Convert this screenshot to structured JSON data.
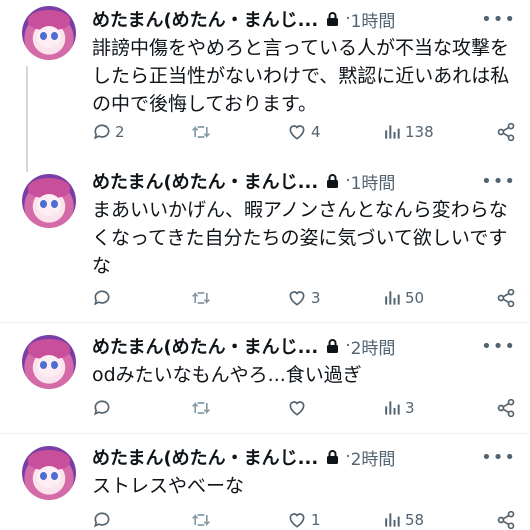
{
  "tweets": [
    {
      "name": "めたまん(めたん・まんじ...",
      "time": "1時間",
      "text": "誹謗中傷をやめろと言っている人が不当な攻撃をしたら正当性がないわけで、黙認に近いあれは私の中で後悔しております。",
      "replies": "2",
      "retweets": "",
      "likes": "4",
      "views": "138"
    },
    {
      "name": "めたまん(めたん・まんじ...",
      "time": "1時間",
      "text": "まあいいかげん、暇アノンさんとなんら変わらなくなってきた自分たちの姿に気づいて欲しいですな",
      "replies": "",
      "retweets": "",
      "likes": "3",
      "views": "50"
    },
    {
      "name": "めたまん(めたん・まんじ...",
      "time": "2時間",
      "text": "odみたいなもんやろ...食い過ぎ",
      "replies": "",
      "retweets": "",
      "likes": "",
      "views": "3"
    },
    {
      "name": "めたまん(めたん・まんじ...",
      "time": "2時間",
      "text": "ストレスやべーな",
      "replies": "",
      "retweets": "",
      "likes": "1",
      "views": "58"
    }
  ],
  "separator": "·",
  "more_glyph": "•••",
  "icons": [
    "lock-icon",
    "reply-icon",
    "retweet-icon",
    "like-icon",
    "views-icon",
    "share-icon"
  ],
  "colors": {
    "text": "#0f1419",
    "muted": "#536471",
    "line": "#cfd9de"
  }
}
